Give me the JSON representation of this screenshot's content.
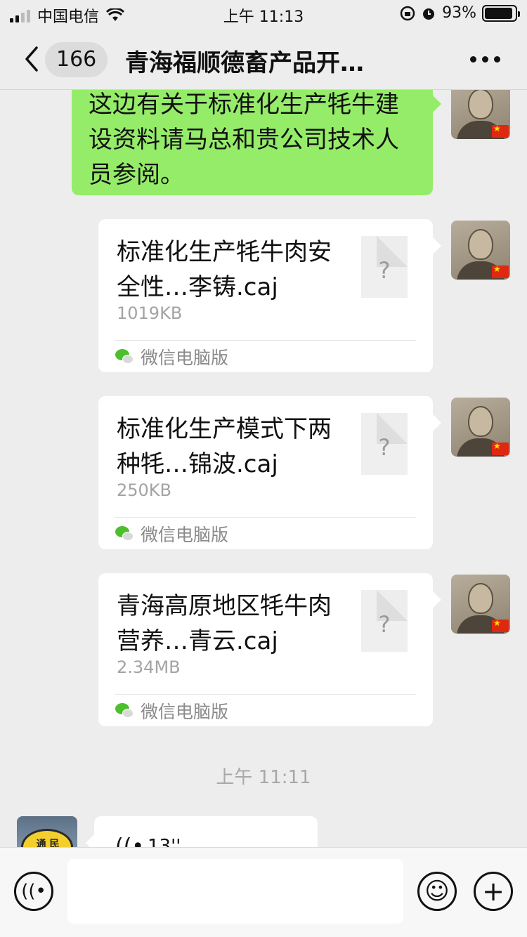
{
  "status_bar": {
    "carrier": "中国电信",
    "time": "上午 11:13",
    "battery": "93%",
    "battery_level": 0.93,
    "icons": [
      "signal-icon",
      "wifi-icon",
      "orientation-lock-icon",
      "alarm-icon",
      "battery-icon"
    ]
  },
  "nav": {
    "unread_count": "166",
    "title": "青海福顺德畜产品开…",
    "icons": [
      "back-chevron-icon",
      "more-dots-icon"
    ]
  },
  "messages": {
    "text_message": "这边有关于标准化生产牦牛建设资料请马总和贵公司技术人员参阅。",
    "files": [
      {
        "name": "标准化生产牦牛肉安全性…李铸.caj",
        "size": "1019KB",
        "source": "微信电脑版",
        "icon_glyph": "?"
      },
      {
        "name": "标准化生产模式下两种牦…锦波.caj",
        "size": "250KB",
        "source": "微信电脑版",
        "icon_glyph": "?"
      },
      {
        "name": "青海高原地区牦牛肉营养…青云.caj",
        "size": "2.34MB",
        "source": "微信电脑版",
        "icon_glyph": "?"
      }
    ],
    "timestamp": "上午 11:11",
    "voice": {
      "duration": "13''",
      "avatar_text": "通 民",
      "voice_glyph": "((•"
    }
  },
  "input_bar": {
    "icons": [
      "voice-input-icon",
      "emoji-icon",
      "plus-icon"
    ],
    "voice_glyph": "((•",
    "emoji_glyph": "☺",
    "plus_glyph": "+"
  },
  "colors": {
    "bubble_green": "#95ec69",
    "background": "#ededed",
    "wechat_green": "#4cbf2c"
  }
}
